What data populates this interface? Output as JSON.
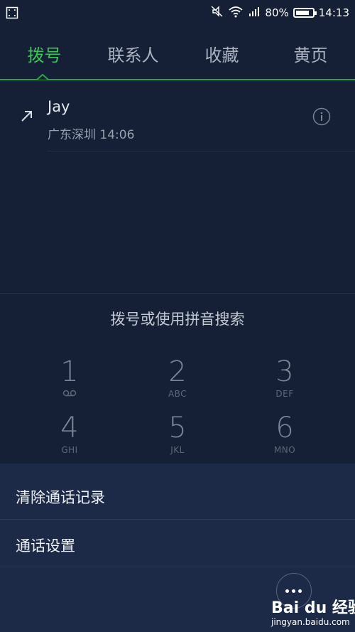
{
  "status_bar": {
    "battery_percent": "80%",
    "time": "14:13",
    "battery_level": 0.8,
    "icons": [
      "screenshot-icon",
      "mute-icon",
      "wifi-icon",
      "signal-icon",
      "battery-icon"
    ]
  },
  "tabs": [
    {
      "label": "拨号",
      "active": true
    },
    {
      "label": "联系人",
      "active": false
    },
    {
      "label": "收藏",
      "active": false
    },
    {
      "label": "黄页",
      "active": false
    }
  ],
  "call_log": [
    {
      "name": "Jay",
      "detail": "广东深圳 14:06",
      "direction_icon": "outgoing-call-arrow-icon"
    }
  ],
  "dialpad": {
    "search_hint": "拨号或使用拼音搜索",
    "keys": [
      {
        "digit": "1",
        "letters": ""
      },
      {
        "digit": "2",
        "letters": "ABC"
      },
      {
        "digit": "3",
        "letters": "DEF"
      },
      {
        "digit": "4",
        "letters": "GHI"
      },
      {
        "digit": "5",
        "letters": "JKL"
      },
      {
        "digit": "6",
        "letters": "MNO"
      }
    ]
  },
  "menu": {
    "items": [
      {
        "label": "清除通话记录"
      },
      {
        "label": "通话设置"
      }
    ]
  },
  "watermark": {
    "main": "Bai du 经验",
    "sub": "jingyan.baidu.com"
  },
  "colors": {
    "background": "#152036",
    "accent": "#3cc35a",
    "menu_background": "#1c2a47"
  }
}
